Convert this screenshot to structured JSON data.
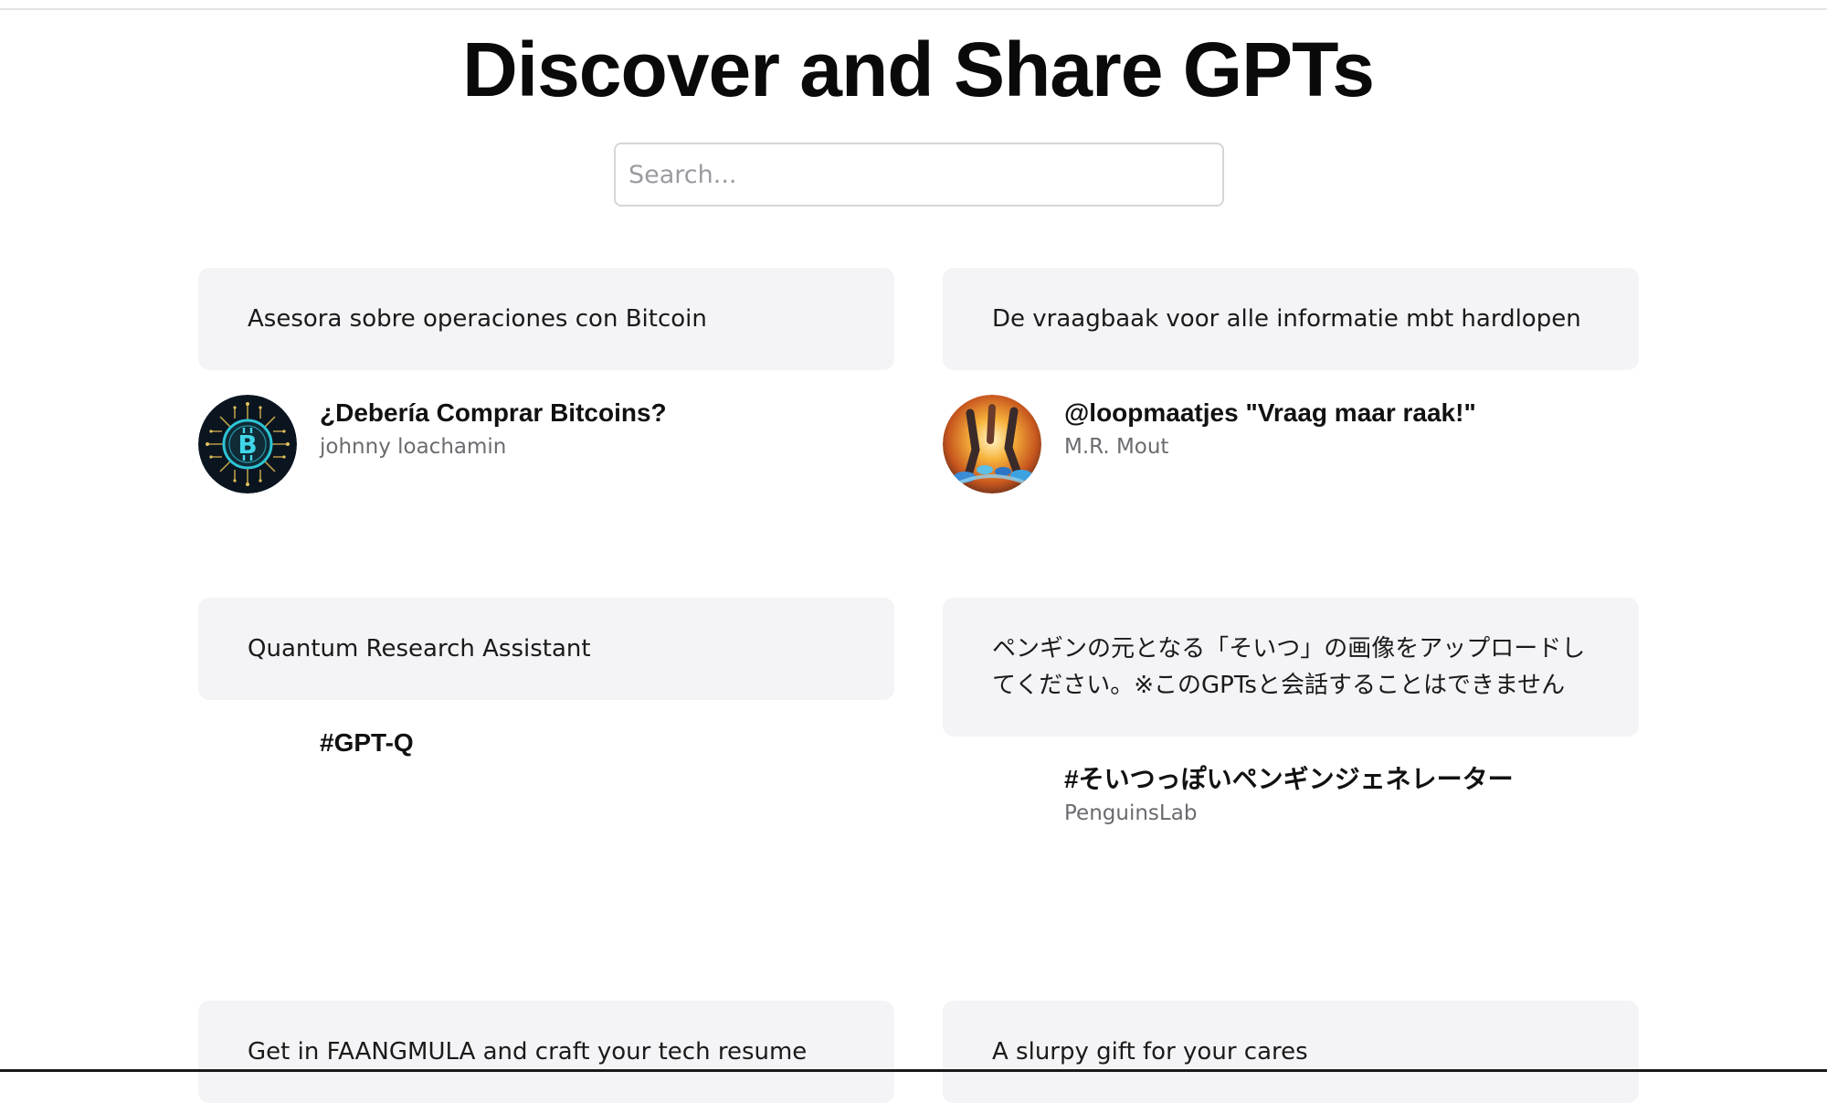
{
  "page": {
    "title": "Discover and Share GPTs"
  },
  "search": {
    "placeholder": "Search..."
  },
  "cards": [
    {
      "description": "Asesora sobre operaciones con Bitcoin",
      "name": "¿Debería Comprar Bitcoins?",
      "author": "johnny loachamin",
      "avatar_icon": "bitcoin-circuit-avatar"
    },
    {
      "description": "De vraagbaak voor alle informatie mbt hardlopen",
      "name": "@loopmaatjes \"Vraag maar raak!\"",
      "author": "M.R. Mout",
      "avatar_icon": "running-shoes-avatar"
    },
    {
      "description": "Quantum Research Assistant",
      "name": "#GPT-Q",
      "author": ""
    },
    {
      "description": "ペンギンの元となる「そいつ」の画像をアップロードしてください。※このGPTsと会話することはできません",
      "name": "#そいつっぽいペンギンジェネレーター",
      "author": "PenguinsLab"
    },
    {
      "description": "Get in FAANGMULA and craft your tech resume",
      "name": "",
      "author": ""
    },
    {
      "description": "A slurpy gift for your cares",
      "name": "",
      "author": ""
    }
  ],
  "colors": {
    "card_background": "#f4f4f7",
    "author_text": "#6b6b70",
    "bitcoin_accent": "#2ec4d6"
  }
}
